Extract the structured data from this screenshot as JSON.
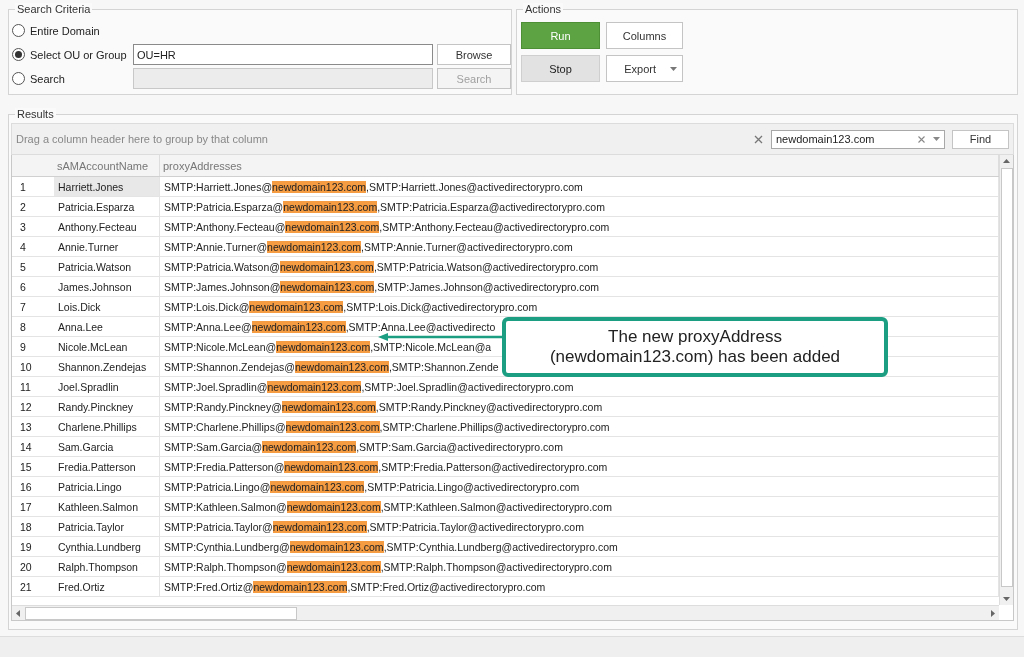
{
  "search_criteria": {
    "title": "Search Criteria",
    "options": [
      {
        "label": "Entire Domain",
        "selected": false
      },
      {
        "label": "Select OU or Group",
        "selected": true,
        "field": {
          "value": "OU=HR",
          "disabled": false
        },
        "button": {
          "label": "Browse",
          "disabled": false
        }
      },
      {
        "label": "Search",
        "selected": false,
        "field": {
          "disabled": true
        },
        "button": {
          "label": "Search",
          "disabled": true
        }
      }
    ]
  },
  "actions": {
    "title": "Actions",
    "buttons": [
      {
        "label": "Run",
        "kind": "primary"
      },
      {
        "label": "Columns",
        "kind": "plain"
      },
      {
        "label": "Stop",
        "kind": "gray"
      },
      {
        "label": "Export",
        "kind": "split"
      }
    ]
  },
  "results": {
    "title": "Results",
    "group_hint": "Drag a column header here to group by that column",
    "find": {
      "value": "newdomain123.com",
      "button": "Find"
    },
    "columns": [
      "sAMAccountName",
      "proxyAddresses"
    ],
    "rows": [
      {
        "index": "1",
        "name": "Harriett.Jones",
        "before": "SMTP:Harriett.Jones@",
        "match": "newdomain123.com",
        "after": ",SMTP:Harriett.Jones@activedirectorypro.com",
        "selected": true
      },
      {
        "index": "2",
        "name": "Patricia.Esparza",
        "before": "SMTP:Patricia.Esparza@",
        "match": "newdomain123.com",
        "after": ",SMTP:Patricia.Esparza@activedirectorypro.com",
        "selected": false
      },
      {
        "index": "3",
        "name": "Anthony.Fecteau",
        "before": "SMTP:Anthony.Fecteau@",
        "match": "newdomain123.com",
        "after": ",SMTP:Anthony.Fecteau@activedirectorypro.com",
        "selected": false
      },
      {
        "index": "4",
        "name": "Annie.Turner",
        "before": "SMTP:Annie.Turner@",
        "match": "newdomain123.com",
        "after": ",SMTP:Annie.Turner@activedirectorypro.com",
        "selected": false
      },
      {
        "index": "5",
        "name": "Patricia.Watson",
        "before": "SMTP:Patricia.Watson@",
        "match": "newdomain123.com",
        "after": ",SMTP:Patricia.Watson@activedirectorypro.com",
        "selected": false
      },
      {
        "index": "6",
        "name": "James.Johnson",
        "before": "SMTP:James.Johnson@",
        "match": "newdomain123.com",
        "after": ",SMTP:James.Johnson@activedirectorypro.com",
        "selected": false
      },
      {
        "index": "7",
        "name": "Lois.Dick",
        "before": "SMTP:Lois.Dick@",
        "match": "newdomain123.com",
        "after": ",SMTP:Lois.Dick@activedirectorypro.com",
        "selected": false
      },
      {
        "index": "8",
        "name": "Anna.Lee",
        "before": "SMTP:Anna.Lee@",
        "match": "newdomain123.com",
        "after": ",SMTP:Anna.Lee@activedirecto",
        "selected": false
      },
      {
        "index": "9",
        "name": "Nicole.McLean",
        "before": "SMTP:Nicole.McLean@",
        "match": "newdomain123.com",
        "after": ",SMTP:Nicole.McLean@a",
        "selected": false
      },
      {
        "index": "10",
        "name": "Shannon.Zendejas",
        "before": "SMTP:Shannon.Zendejas@",
        "match": "newdomain123.com",
        "after": ",SMTP:Shannon.Zende",
        "selected": false
      },
      {
        "index": "11",
        "name": "Joel.Spradlin",
        "before": "SMTP:Joel.Spradlin@",
        "match": "newdomain123.com",
        "after": ",SMTP:Joel.Spradlin@activedirectorypro.com",
        "selected": false
      },
      {
        "index": "12",
        "name": "Randy.Pinckney",
        "before": "SMTP:Randy.Pinckney@",
        "match": "newdomain123.com",
        "after": ",SMTP:Randy.Pinckney@activedirectorypro.com",
        "selected": false
      },
      {
        "index": "13",
        "name": "Charlene.Phillips",
        "before": "SMTP:Charlene.Phillips@",
        "match": "newdomain123.com",
        "after": ",SMTP:Charlene.Phillips@activedirectorypro.com",
        "selected": false
      },
      {
        "index": "14",
        "name": "Sam.Garcia",
        "before": "SMTP:Sam.Garcia@",
        "match": "newdomain123.com",
        "after": ",SMTP:Sam.Garcia@activedirectorypro.com",
        "selected": false
      },
      {
        "index": "15",
        "name": "Fredia.Patterson",
        "before": "SMTP:Fredia.Patterson@",
        "match": "newdomain123.com",
        "after": ",SMTP:Fredia.Patterson@activedirectorypro.com",
        "selected": false
      },
      {
        "index": "16",
        "name": "Patricia.Lingo",
        "before": "SMTP:Patricia.Lingo@",
        "match": "newdomain123.com",
        "after": ",SMTP:Patricia.Lingo@activedirectorypro.com",
        "selected": false
      },
      {
        "index": "17",
        "name": "Kathleen.Salmon",
        "before": "SMTP:Kathleen.Salmon@",
        "match": "newdomain123.com",
        "after": ",SMTP:Kathleen.Salmon@activedirectorypro.com",
        "selected": false
      },
      {
        "index": "18",
        "name": "Patricia.Taylor",
        "before": "SMTP:Patricia.Taylor@",
        "match": "newdomain123.com",
        "after": ",SMTP:Patricia.Taylor@activedirectorypro.com",
        "selected": false
      },
      {
        "index": "19",
        "name": "Cynthia.Lundberg",
        "before": "SMTP:Cynthia.Lundberg@",
        "match": "newdomain123.com",
        "after": ",SMTP:Cynthia.Lundberg@activedirectorypro.com",
        "selected": false
      },
      {
        "index": "20",
        "name": "Ralph.Thompson",
        "before": "SMTP:Ralph.Thompson@",
        "match": "newdomain123.com",
        "after": ",SMTP:Ralph.Thompson@activedirectorypro.com",
        "selected": false
      },
      {
        "index": "21",
        "name": "Fred.Ortiz",
        "before": "SMTP:Fred.Ortiz@",
        "match": "newdomain123.com",
        "after": ",SMTP:Fred.Ortiz@activedirectorypro.com",
        "selected": false
      }
    ]
  },
  "annotation": {
    "text": "The new proxyAddress (newdomain123.com) has been added"
  }
}
